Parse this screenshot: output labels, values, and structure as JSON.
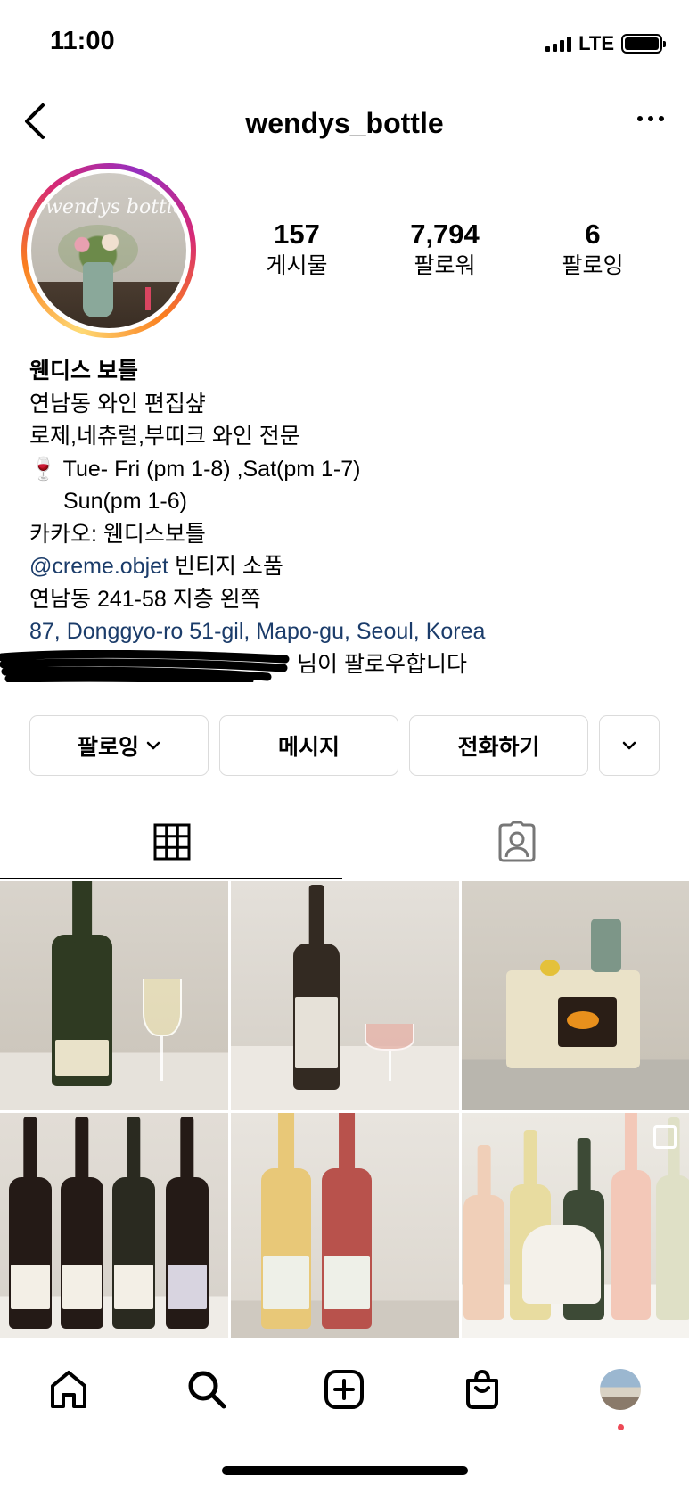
{
  "status_bar": {
    "time": "11:00",
    "network": "LTE"
  },
  "header": {
    "username": "wendys_bottle"
  },
  "profile": {
    "avatar_text": "wendys bottle",
    "stats": [
      {
        "value": "157",
        "label": "게시물"
      },
      {
        "value": "7,794",
        "label": "팔로워"
      },
      {
        "value": "6",
        "label": "팔로잉"
      }
    ]
  },
  "bio": {
    "name": "웬디스 보틀",
    "line1": "연남동 와인 편집샾",
    "line2": "로제,네츄럴,부띠크 와인 전문",
    "hours_emoji": "🍷",
    "hours1": "Tue- Fri (pm 1-8) ,Sat(pm 1-7)",
    "hours2": "Sun(pm 1-6)",
    "kakao": "카카오: 웬디스보틀",
    "mention": "@creme.objet",
    "mention_suffix": " 빈티지 소품",
    "address_kr": "연남동 241-58 지층 왼쪽",
    "address_en": "87, Donggyo-ro 51-gil, Mapo-gu, Seoul, Korea",
    "followed_by": "님이 팔로우합니다"
  },
  "actions": {
    "following": "팔로잉",
    "message": "메시지",
    "call": "전화하기"
  },
  "colors": {
    "link": "#1b3c6a",
    "notification": "#ed4956",
    "border": "#dbdbdb"
  }
}
